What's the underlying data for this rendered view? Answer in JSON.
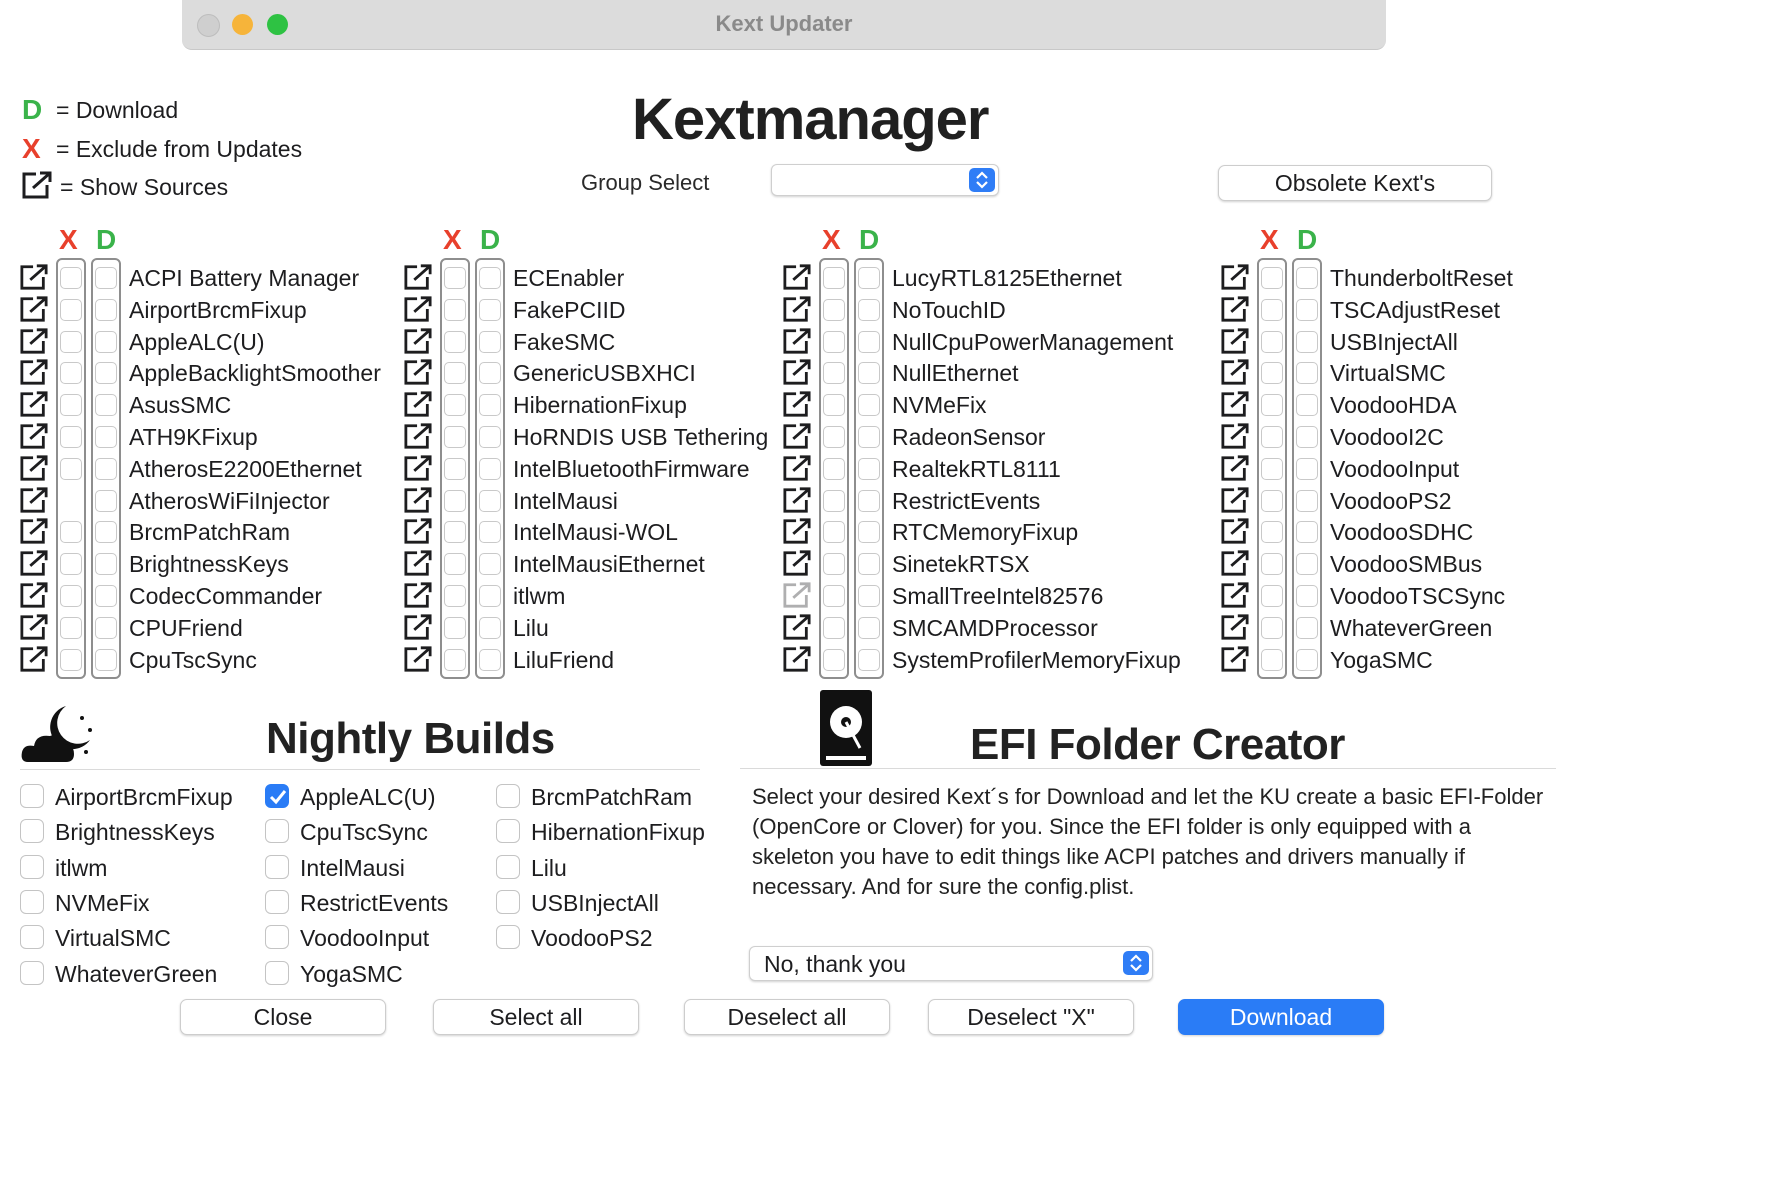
{
  "window": {
    "title": "Kext Updater"
  },
  "legend": [
    {
      "symbol": "D",
      "text": "= Download",
      "color": "#3ab34a"
    },
    {
      "symbol": "X",
      "text": "= Exclude from Updates",
      "color": "#e8402c"
    },
    {
      "symbol": "external-link-icon",
      "text": "= Show Sources"
    }
  ],
  "header": {
    "title": "Kextmanager",
    "group_select_label": "Group Select",
    "group_select_value": "",
    "obsolete_button": "Obsolete Kext's"
  },
  "columns": {
    "x_label": "X",
    "d_label": "D",
    "lists": [
      [
        "ACPI Battery Manager",
        "AirportBrcmFixup",
        "AppleALC(U)",
        "AppleBacklightSmoother",
        "AsusSMC",
        "ATH9KFixup",
        "AtherosE2200Ethernet",
        "AtherosWiFiInjector",
        "BrcmPatchRam",
        "BrightnessKeys",
        "CodecCommander",
        "CPUFriend",
        "CpuTscSync"
      ],
      [
        "ECEnabler",
        "FakePCIID",
        "FakeSMC",
        "GenericUSBXHCI",
        "HibernationFixup",
        "HoRNDIS USB Tethering",
        "IntelBluetoothFirmware",
        "IntelMausi",
        "IntelMausi-WOL",
        "IntelMausiEthernet",
        "itlwm",
        "Lilu",
        "LiluFriend"
      ],
      [
        "LucyRTL8125Ethernet",
        "NoTouchID",
        "NullCpuPowerManagement",
        "NullEthernet",
        "NVMeFix",
        "RadeonSensor",
        "RealtekRTL8111",
        "RestrictEvents",
        "RTCMemoryFixup",
        "SinetekRTSX",
        "SmallTreeIntel82576",
        "SMCAMDProcessor",
        "SystemProfilerMemoryFixup"
      ],
      [
        "ThunderboltReset",
        "TSCAdjustReset",
        "USBInjectAll",
        "VirtualSMC",
        "VoodooHDA",
        "VoodooI2C",
        "VoodooInput",
        "VoodooPS2",
        "VoodooSDHC",
        "VoodooSMBus",
        "VoodooTSCSync",
        "WhateverGreen",
        "YogaSMC"
      ]
    ]
  },
  "nightly": {
    "title": "Nightly Builds",
    "items": [
      {
        "label": "AirportBrcmFixup",
        "checked": false
      },
      {
        "label": "AppleALC(U)",
        "checked": true
      },
      {
        "label": "BrcmPatchRam",
        "checked": false
      },
      {
        "label": "BrightnessKeys",
        "checked": false
      },
      {
        "label": "CpuTscSync",
        "checked": false
      },
      {
        "label": "HibernationFixup",
        "checked": false
      },
      {
        "label": "itlwm",
        "checked": false
      },
      {
        "label": "IntelMausi",
        "checked": false
      },
      {
        "label": "Lilu",
        "checked": false
      },
      {
        "label": "NVMeFix",
        "checked": false
      },
      {
        "label": "RestrictEvents",
        "checked": false
      },
      {
        "label": "USBInjectAll",
        "checked": false
      },
      {
        "label": "VirtualSMC",
        "checked": false
      },
      {
        "label": "VoodooInput",
        "checked": false
      },
      {
        "label": "VoodooPS2",
        "checked": false
      },
      {
        "label": "WhateverGreen",
        "checked": false
      },
      {
        "label": "YogaSMC",
        "checked": false
      }
    ]
  },
  "efi": {
    "title": "EFI Folder Creator",
    "description": "Select your desired Kext´s for Download and let the KU create a basic EFI-Folder (OpenCore or Clover) for you. Since the EFI folder is only equipped with a skeleton you have to edit things like ACPI patches and drivers manually if necessary. And for sure the config.plist.",
    "select_value": "No, thank you"
  },
  "footer": {
    "close": "Close",
    "select_all": "Select all",
    "deselect_all": "Deselect all",
    "deselect_x": "Deselect \"X\"",
    "download": "Download"
  },
  "colors": {
    "accent": "#2a7cf6",
    "x_red": "#e8402c",
    "d_green": "#3ab34a"
  }
}
